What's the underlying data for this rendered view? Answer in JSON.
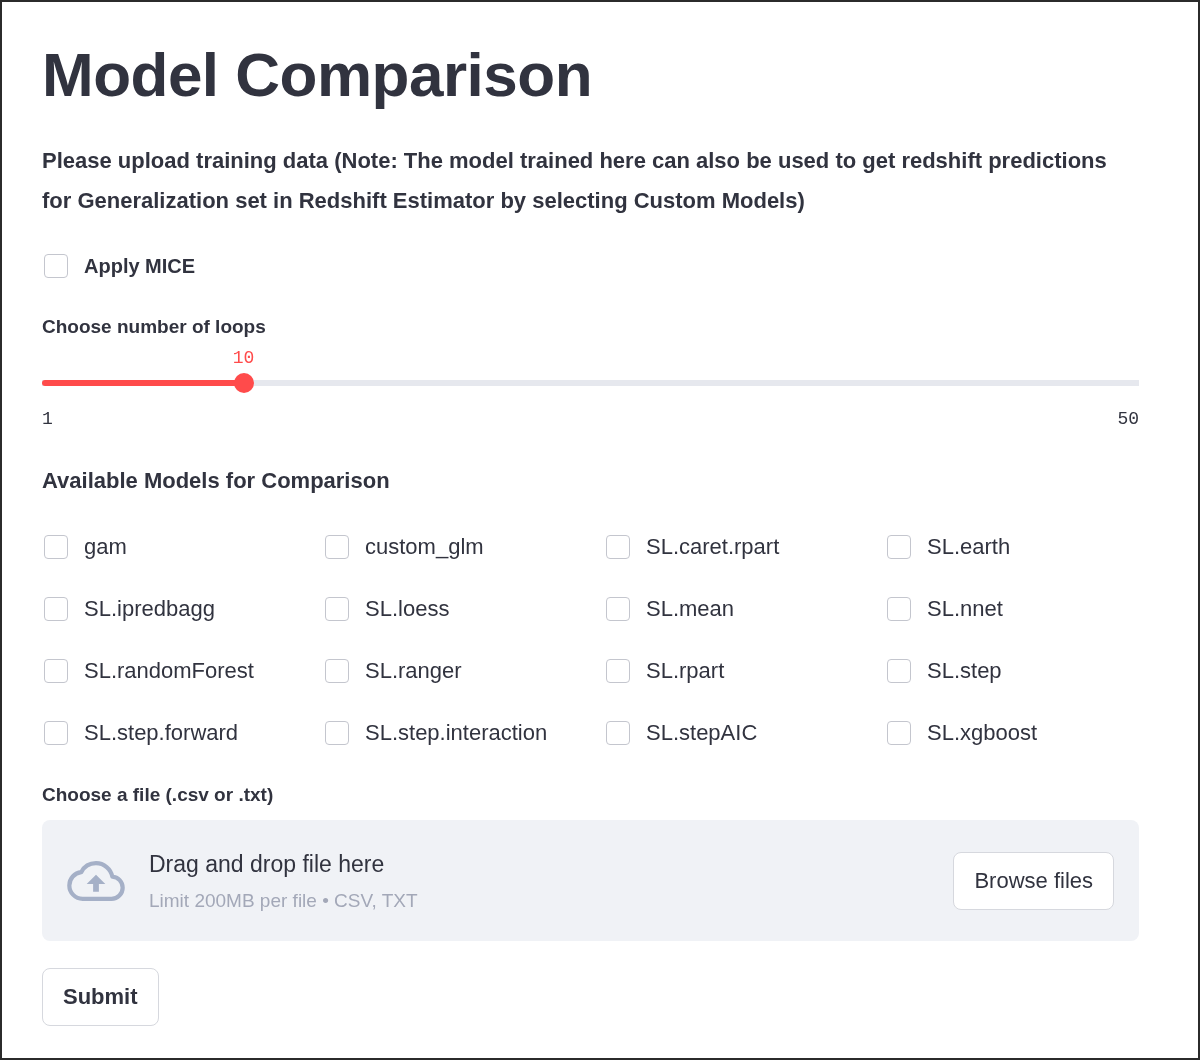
{
  "title": "Model Comparison",
  "intro": "Please upload training data (Note: The model trained here can also be used to get redshift predictions for Generalization set in Redshift Estimator by selecting Custom Models)",
  "mice": {
    "label": "Apply MICE",
    "checked": false
  },
  "slider": {
    "label": "Choose number of loops",
    "value": "10",
    "level": 0.1837,
    "min": "1",
    "max": "50"
  },
  "models": {
    "heading": "Available Models for Comparison",
    "items": [
      {
        "label": "gam",
        "checked": false
      },
      {
        "label": "custom_glm",
        "checked": false
      },
      {
        "label": "SL.caret.rpart",
        "checked": false
      },
      {
        "label": "SL.earth",
        "checked": false
      },
      {
        "label": "SL.ipredbagg",
        "checked": false
      },
      {
        "label": "SL.loess",
        "checked": false
      },
      {
        "label": "SL.mean",
        "checked": false
      },
      {
        "label": "SL.nnet",
        "checked": false
      },
      {
        "label": "SL.randomForest",
        "checked": false
      },
      {
        "label": "SL.ranger",
        "checked": false
      },
      {
        "label": "SL.rpart",
        "checked": false
      },
      {
        "label": "SL.step",
        "checked": false
      },
      {
        "label": "SL.step.forward",
        "checked": false
      },
      {
        "label": "SL.step.interaction",
        "checked": false
      },
      {
        "label": "SL.stepAIC",
        "checked": false
      },
      {
        "label": "SL.xgboost",
        "checked": false
      }
    ]
  },
  "uploader": {
    "label": "Choose a file (.csv or .txt)",
    "drop_text": "Drag and drop file here",
    "limit_text": "Limit 200MB per file • CSV, TXT",
    "browse_button": "Browse files"
  },
  "submit_button": "Submit"
}
